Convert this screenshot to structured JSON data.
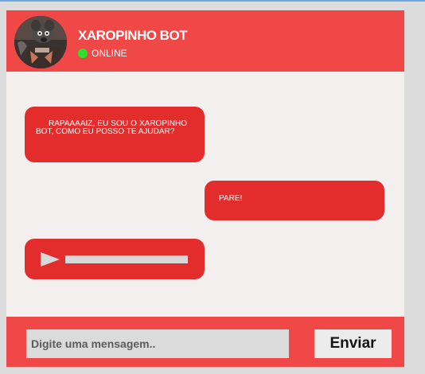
{
  "header": {
    "bot_name": "XAROPINHO BOT",
    "status_text": "ONLINE",
    "status_color": "#2ee02e",
    "avatar_icon": "bot-avatar-photo"
  },
  "messages": [
    {
      "sender": "bot",
      "text": "RAPAAAAIZ, EU SOU O XAROPINHO BOT, COMO EU POSSO TE AJUDAR?"
    },
    {
      "sender": "user",
      "text": "PARE!"
    },
    {
      "sender": "bot",
      "type": "audio",
      "play_icon": "play-icon",
      "progress": 0
    }
  ],
  "composer": {
    "placeholder": "Digite uma mensagem..",
    "value": "",
    "send_label": "Enviar"
  },
  "colors": {
    "accent": "#f04747",
    "bubble": "#e32d2d",
    "background": "#f2efee",
    "page": "#dcdcdc"
  }
}
